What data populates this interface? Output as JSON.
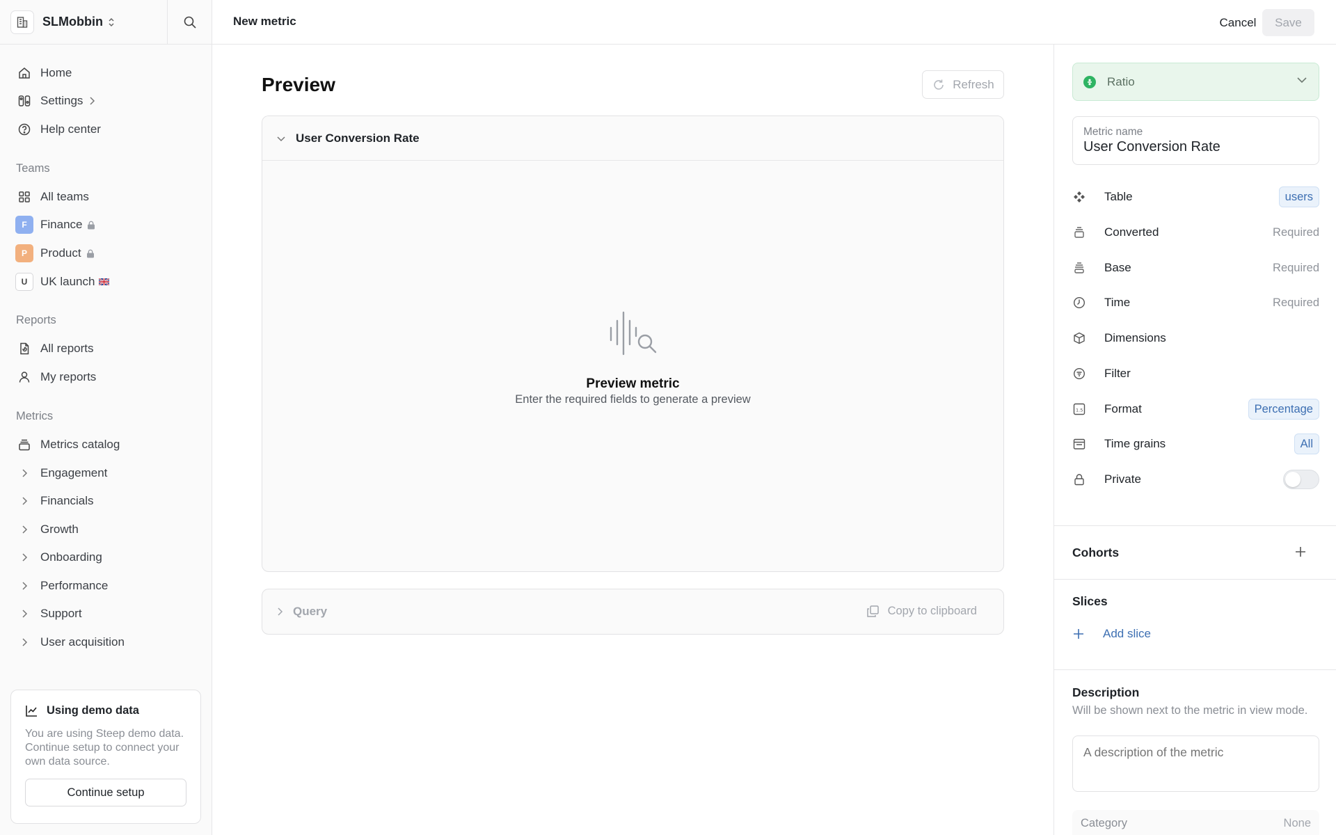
{
  "sidebar": {
    "workspace": "SLMobbin",
    "nav": [
      {
        "label": "Home",
        "icon": "home-icon"
      },
      {
        "label": "Settings",
        "icon": "settings-icon"
      },
      {
        "label": "Help center",
        "icon": "help-icon"
      }
    ],
    "teams_heading": "Teams",
    "teams": [
      {
        "label": "All teams",
        "icon": "grid-icon"
      },
      {
        "label": "Finance",
        "badge": "F",
        "badge_color": "#8fb0f0",
        "locked": true
      },
      {
        "label": "Product",
        "badge": "P",
        "badge_color": "#f2b07e",
        "locked": true
      },
      {
        "label": "UK launch",
        "badge": "U",
        "badge_color": "#ffffff",
        "flag": true
      }
    ],
    "reports_heading": "Reports",
    "reports": [
      {
        "label": "All reports",
        "icon": "report-icon"
      },
      {
        "label": "My reports",
        "icon": "user-icon"
      }
    ],
    "metrics_heading": "Metrics",
    "metrics_catalog": "Metrics catalog",
    "metric_groups": [
      "Engagement",
      "Financials",
      "Growth",
      "Onboarding",
      "Performance",
      "Support",
      "User acquisition"
    ],
    "demo": {
      "title": "Using demo data",
      "text": "You are using Steep demo data. Continue setup to connect your own data source.",
      "button": "Continue setup"
    }
  },
  "header": {
    "title": "New metric",
    "cancel": "Cancel",
    "save": "Save"
  },
  "preview": {
    "title": "Preview",
    "refresh": "Refresh",
    "card_title": "User Conversion Rate",
    "empty_title": "Preview metric",
    "empty_text": "Enter the required fields to generate a preview",
    "query_label": "Query",
    "copy": "Copy to clipboard"
  },
  "panel": {
    "type": "Ratio",
    "metric_name_label": "Metric name",
    "metric_name": "User Conversion Rate",
    "props": [
      {
        "label": "Table",
        "tag": "users",
        "icon": "table-icon"
      },
      {
        "label": "Converted",
        "value": "Required",
        "icon": "measure-icon"
      },
      {
        "label": "Base",
        "value": "Required",
        "icon": "measure-base-icon"
      },
      {
        "label": "Time",
        "value": "Required",
        "icon": "clock-icon"
      },
      {
        "label": "Dimensions",
        "icon": "cube-icon"
      },
      {
        "label": "Filter",
        "icon": "filter-icon"
      },
      {
        "label": "Format",
        "tag": "Percentage",
        "icon": "format-icon"
      },
      {
        "label": "Time grains",
        "tag": "All",
        "icon": "calendar-icon"
      },
      {
        "label": "Private",
        "icon": "lock-icon",
        "toggle": false
      }
    ],
    "cohorts": "Cohorts",
    "slices": "Slices",
    "add_slice": "Add slice",
    "description": "Description",
    "description_sub": "Will be shown next to the metric in view mode.",
    "description_placeholder": "A description of the metric",
    "category_label": "Category",
    "category_value": "None"
  },
  "colors": {
    "accent_blue": "#3d6fb2",
    "ratio_green": "#2fb463",
    "muted": "#a2a6ad"
  }
}
